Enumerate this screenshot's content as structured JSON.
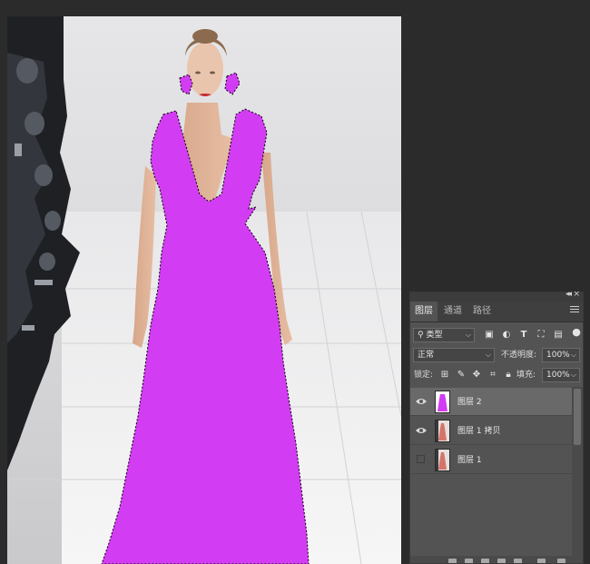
{
  "canvas": {
    "image_name": "runway-model-photo",
    "selection_color": "#d23cf2"
  },
  "panel": {
    "tabs": [
      {
        "label": "图层",
        "active": true
      },
      {
        "label": "通道",
        "active": false
      },
      {
        "label": "路径",
        "active": false
      }
    ],
    "filter": {
      "label": "类型"
    },
    "blend_mode": "正常",
    "opacity": {
      "label": "不透明度:",
      "value": "100%"
    },
    "lock": {
      "label": "锁定:"
    },
    "fill": {
      "label": "填充:",
      "value": "100%"
    },
    "layers": [
      {
        "name": "图层 2",
        "visible": true,
        "selected": true,
        "thumb": "purple-dress"
      },
      {
        "name": "图层 1 拷贝",
        "visible": true,
        "selected": false,
        "thumb": "model-photo"
      },
      {
        "name": "图层 1",
        "visible": false,
        "selected": false,
        "thumb": "model-photo"
      }
    ]
  }
}
